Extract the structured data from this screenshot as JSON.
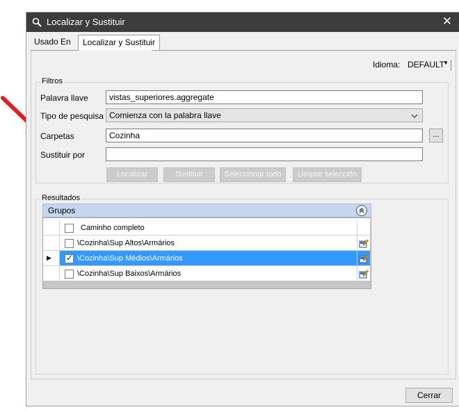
{
  "window": {
    "title": "Localizar y Sustituir",
    "close_glyph": "✕"
  },
  "tabs": [
    {
      "label": "Usado En"
    },
    {
      "label": "Localizar y Sustituir"
    }
  ],
  "idioma": {
    "label": "Idioma:",
    "value": "DEFAULT",
    "caret": "▼"
  },
  "filtros": {
    "legend": "Filtros",
    "palavra_label": "Palavra llave",
    "palavra_value": "vistas_superiores.aggregate",
    "tipo_label": "Tipo de pesquisa",
    "tipo_value": "Comienza con la palabra llave",
    "carpetas_label": "Carpetas",
    "carpetas_value": "Cozinha",
    "browse_label": "...",
    "sustituir_label": "Sustituir por",
    "sustituir_value": "",
    "buttons": {
      "localizar": "Localizar",
      "sustituir": "Sustituir",
      "seleccionar_todo": "Seleccionar todo",
      "limpiar": "Limpiar selección"
    }
  },
  "resultados": {
    "legend": "Resultados",
    "group_label": "Grupos",
    "column_header": "Caminho completo",
    "rows": [
      {
        "path": "\\Cozinha\\Sup Altos\\Armários",
        "checked": false,
        "selected": false
      },
      {
        "path": "\\Cozinha\\Sup Médios\\Armários",
        "checked": true,
        "selected": true
      },
      {
        "path": "\\Cozinha\\Sup Baixos\\Armários",
        "checked": false,
        "selected": false
      }
    ]
  },
  "footer": {
    "close_label": "Cerrar"
  },
  "colors": {
    "titlebar": "#3c3c3c",
    "selection": "#3399ff",
    "group_header": "#c5d6ee",
    "arrow": "#e02020"
  }
}
